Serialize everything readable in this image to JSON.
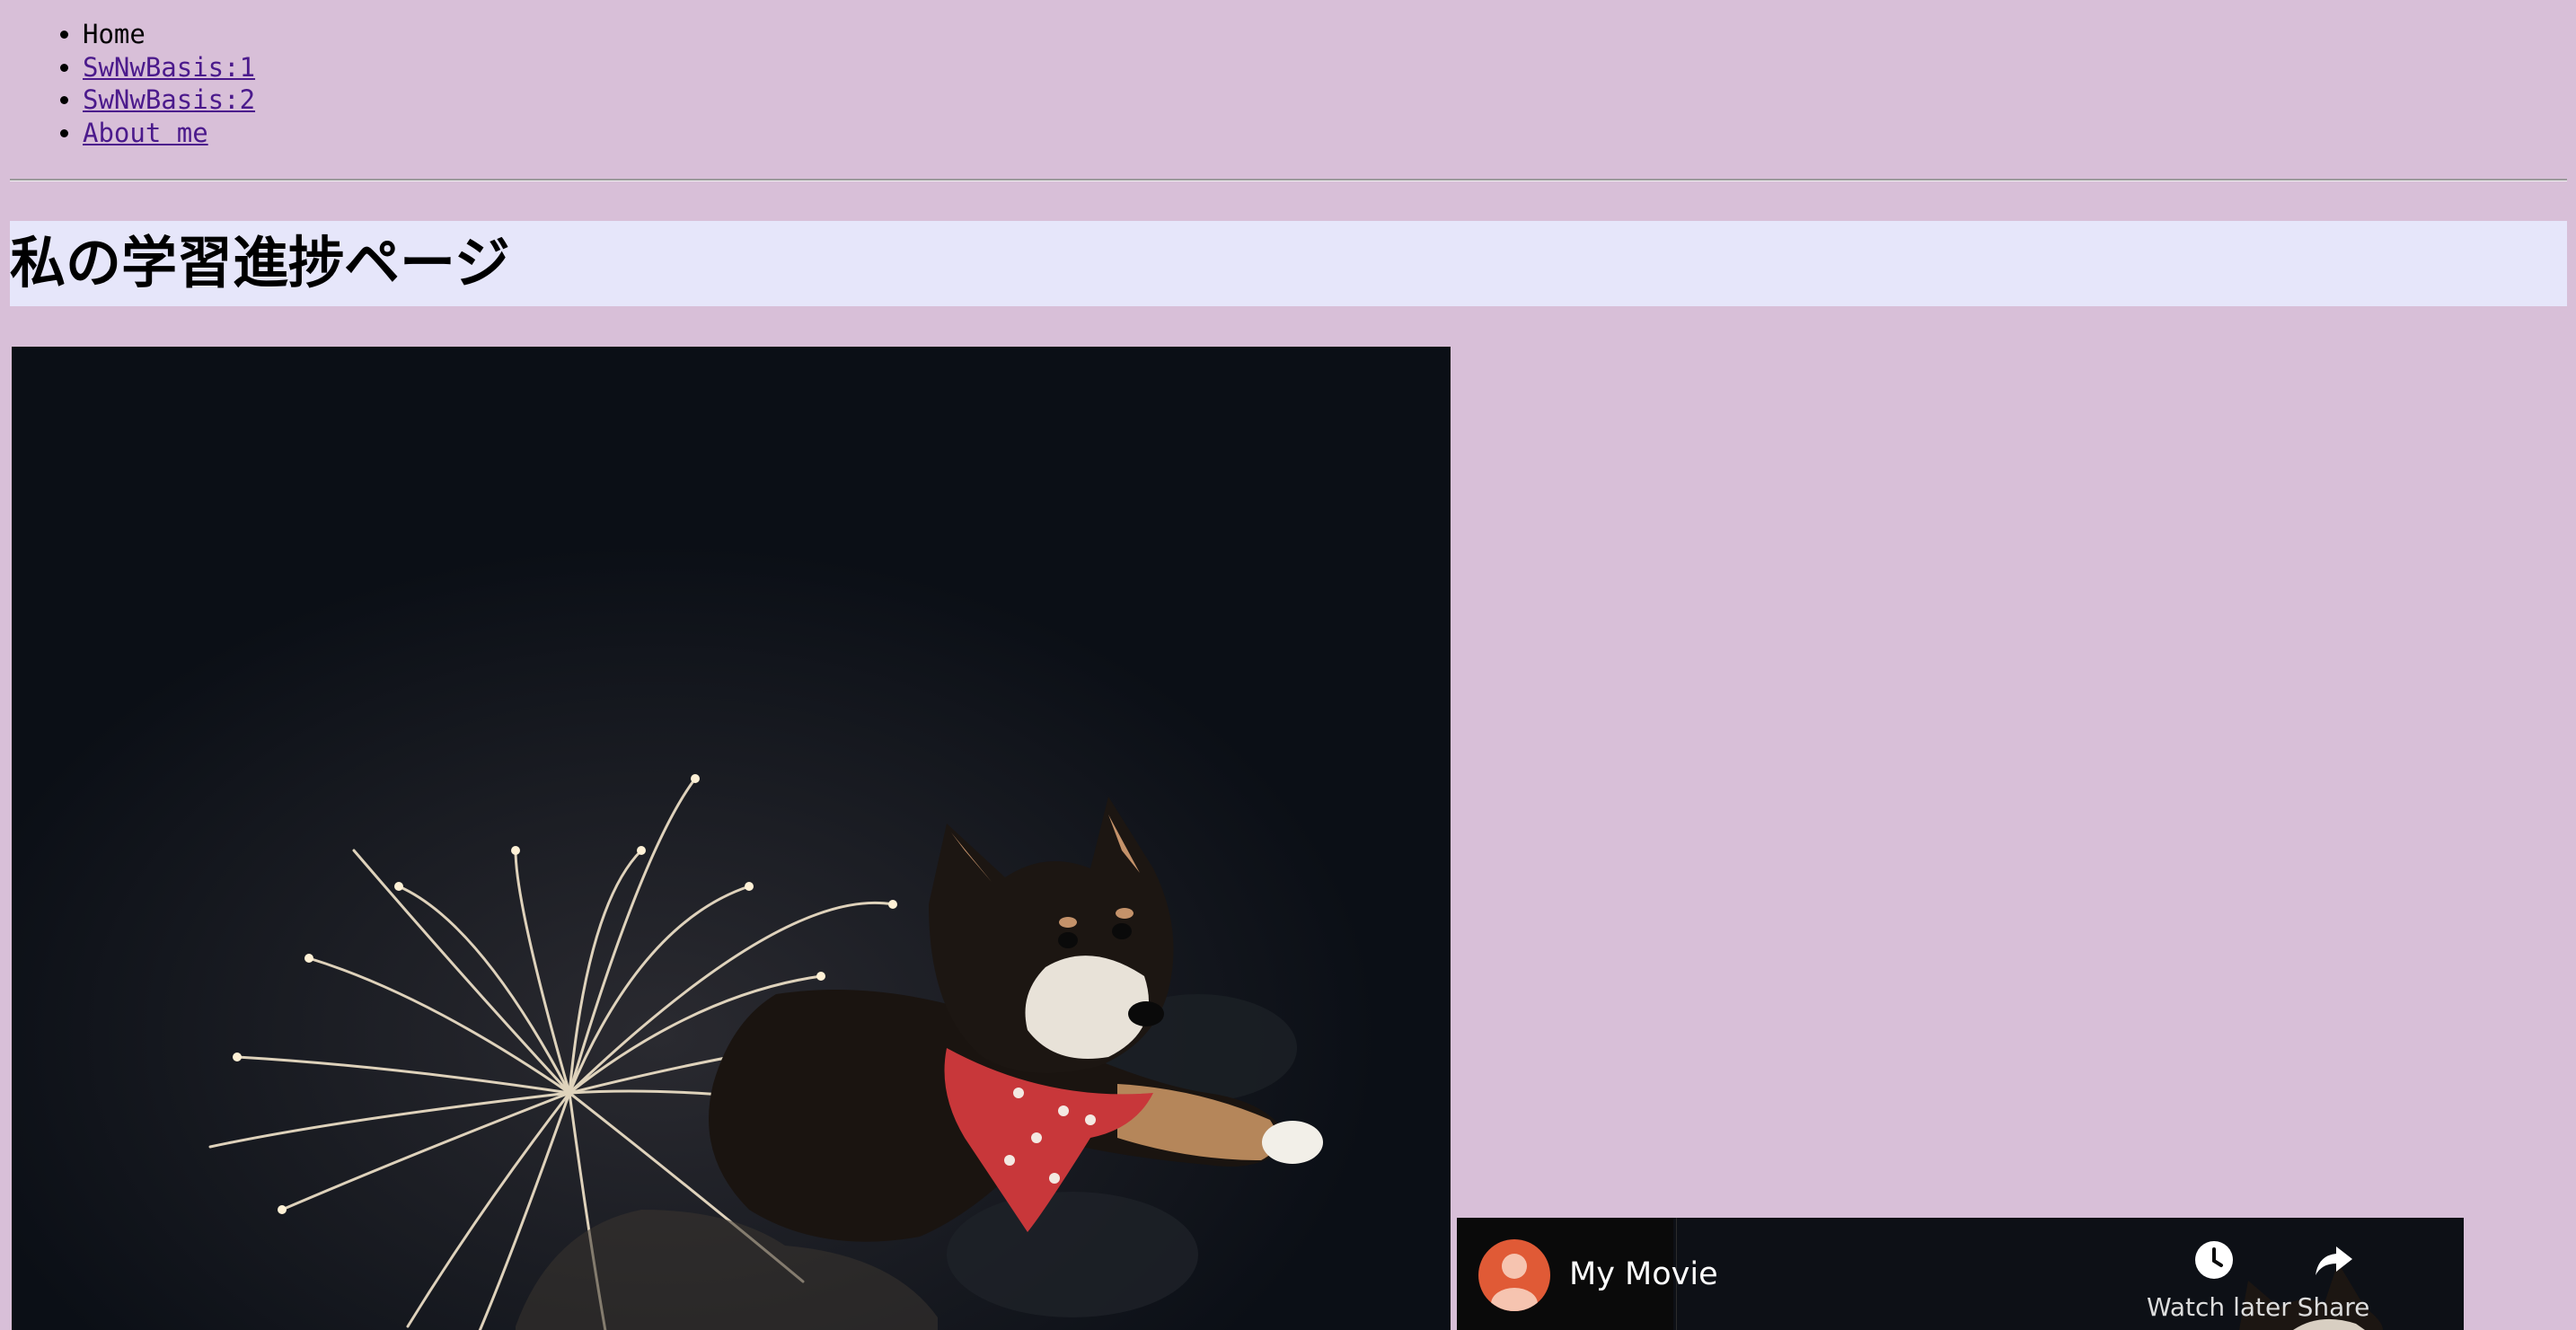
{
  "nav": {
    "items": [
      {
        "label": "Home",
        "is_link": false
      },
      {
        "label": "SwNwBasis:1",
        "is_link": true
      },
      {
        "label": "SwNwBasis:2",
        "is_link": true
      },
      {
        "label": "About me",
        "is_link": true
      }
    ]
  },
  "header": {
    "title": "私の学習進捗ページ"
  },
  "image": {
    "icon": "shiba-dog-fireworks-photo"
  },
  "video": {
    "title": "My Movie",
    "watch_later_label": "Watch later",
    "share_label": "Share",
    "avatar_icon": "user-avatar-icon"
  },
  "colors": {
    "page_background": "#d8bfd8",
    "title_band": "#e6e6fa",
    "link": "#4b1a8c",
    "avatar": "#e05a36"
  }
}
